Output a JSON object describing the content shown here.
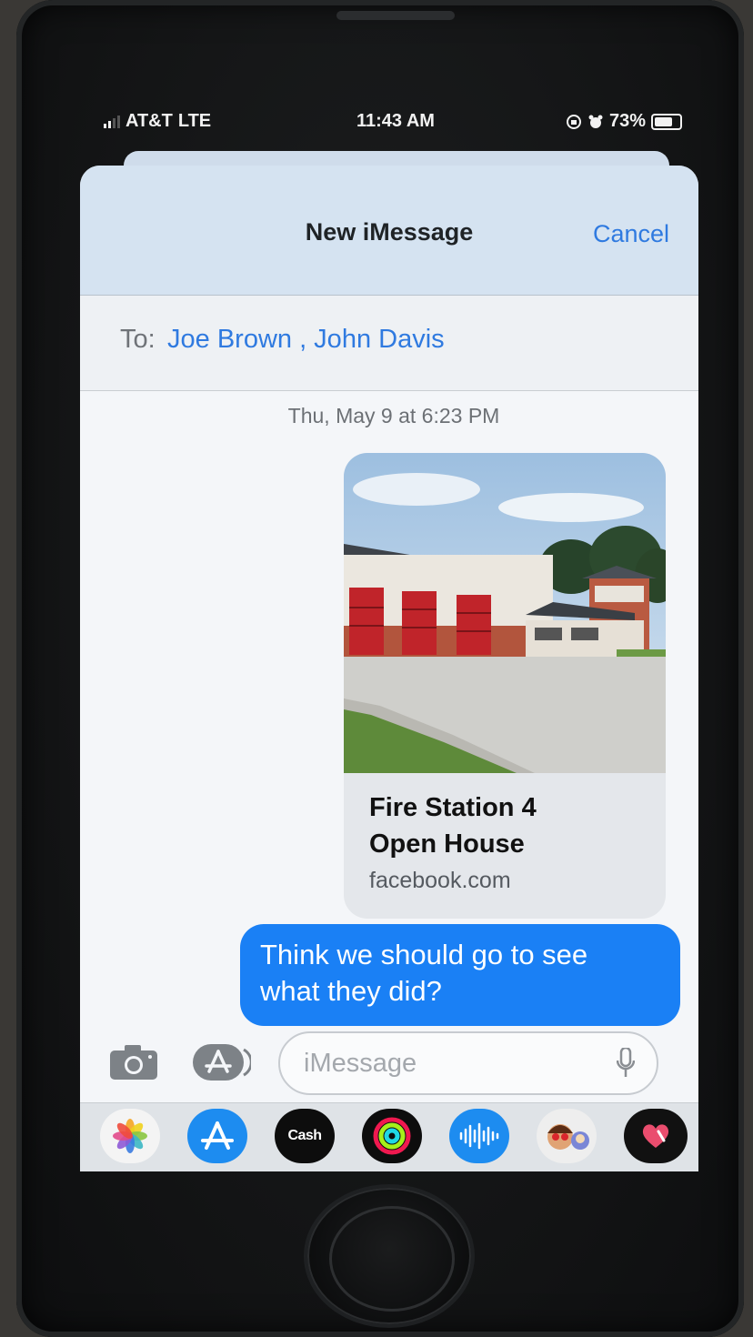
{
  "status_bar": {
    "carrier": "AT&T",
    "network": "LTE",
    "time": "11:43 AM",
    "battery_percent": "73%",
    "icons": [
      "signal-icon",
      "rotation-lock-icon",
      "alarm-icon",
      "battery-icon"
    ]
  },
  "header": {
    "title": "New iMessage",
    "cancel_label": "Cancel"
  },
  "to_field": {
    "label": "To:",
    "recipients_text": "Joe  Brown , John Davis"
  },
  "conversation": {
    "timestamp": "Thu, May 9 at 6:23 PM",
    "link_preview": {
      "title_line1": "Fire Station 4",
      "title_line2": "Open House",
      "domain": "facebook.com",
      "image": "fire-station-photo"
    },
    "sent_message_line1": "Think we should go to see",
    "sent_message_line2": "what they did?"
  },
  "composer": {
    "placeholder": "iMessage",
    "icons": [
      "camera-icon",
      "app-store-icon",
      "microphone-icon"
    ]
  },
  "app_drawer": {
    "apps": [
      {
        "name": "photos-app-icon"
      },
      {
        "name": "app-store-app-icon"
      },
      {
        "name": "apple-cash-app-icon",
        "label": "Cash"
      },
      {
        "name": "activity-app-icon"
      },
      {
        "name": "audio-message-app-icon"
      },
      {
        "name": "memoji-app-icon"
      },
      {
        "name": "digital-touch-app-icon"
      }
    ]
  },
  "colors": {
    "accent_blue": "#2f7ae0",
    "bubble_blue": "#1a80f5",
    "header_bg": "#d5e3f1"
  }
}
